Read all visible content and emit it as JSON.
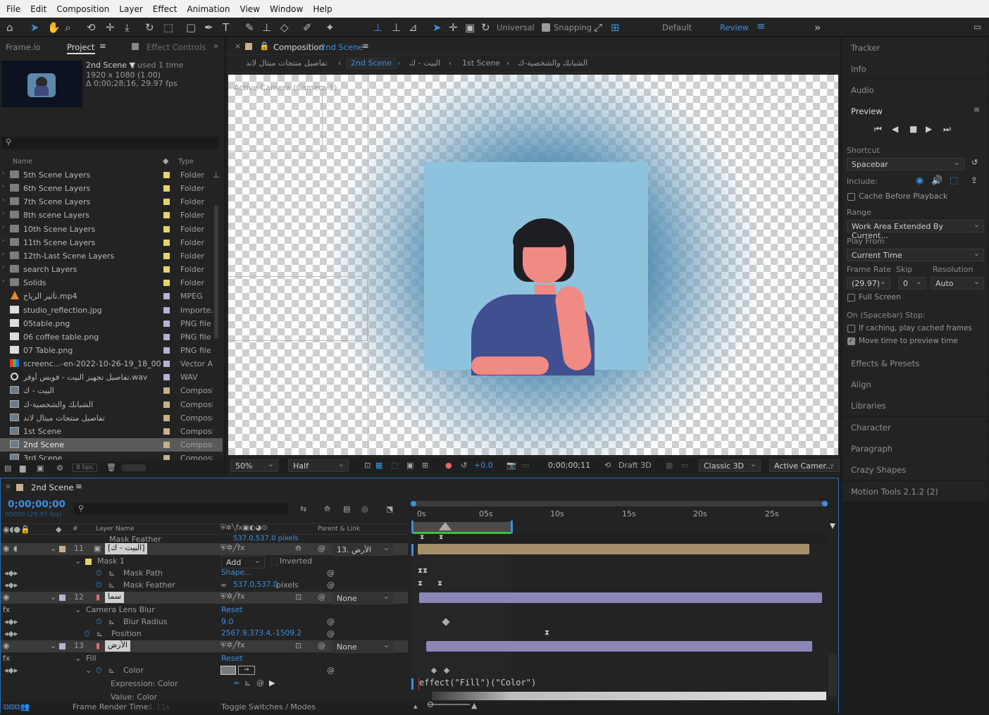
{
  "menu": [
    "File",
    "Edit",
    "Composition",
    "Layer",
    "Effect",
    "Animation",
    "View",
    "Window",
    "Help"
  ],
  "toolbar": {
    "universal": "Universal",
    "snapping": "Snapping",
    "workspace_default": "Default",
    "workspace_review": "Review"
  },
  "left_tabs": {
    "frameio": "Frame.io",
    "project": "Project",
    "effect_controls": "Effect Controls"
  },
  "project_info": {
    "name": "2nd Scene ▼",
    "used": ", used 1 time",
    "size": "1920 x 1080 (1.00)",
    "duration": "Δ 0;00;28;16, 29.97 fps"
  },
  "project_columns": {
    "name": "Name",
    "type": "Type"
  },
  "project_items": [
    {
      "name": "5th Scene Layers",
      "type": "Folder",
      "kind": "folder",
      "label": "#e8d36a"
    },
    {
      "name": "6th Scene Layers",
      "type": "Folder",
      "kind": "folder",
      "label": "#e8d36a"
    },
    {
      "name": "7th Scene Layers",
      "type": "Folder",
      "kind": "folder",
      "label": "#e8d36a"
    },
    {
      "name": "8th scene Layers",
      "type": "Folder",
      "kind": "folder",
      "label": "#e8d36a"
    },
    {
      "name": "10th Scene Layers",
      "type": "Folder",
      "kind": "folder",
      "label": "#e8d36a"
    },
    {
      "name": "11th Scene Layers",
      "type": "Folder",
      "kind": "folder",
      "label": "#e8d36a"
    },
    {
      "name": "12th-Last Scene Layers",
      "type": "Folder",
      "kind": "folder",
      "label": "#e8d36a"
    },
    {
      "name": "search Layers",
      "type": "Folder",
      "kind": "folder",
      "label": "#e8d36a"
    },
    {
      "name": "Solids",
      "type": "Folder",
      "kind": "folder",
      "label": "#e8d36a"
    },
    {
      "name": "تأثير الرياح.mp4",
      "type": "MPEG",
      "kind": "vlc",
      "label": "#b3b3d6"
    },
    {
      "name": "studio_reflection.jpg",
      "type": "Importe...",
      "kind": "file",
      "label": "#b3b3d6"
    },
    {
      "name": "05table.png",
      "type": "PNG file",
      "kind": "file",
      "label": "#b3b3d6"
    },
    {
      "name": "06 coffee table.png",
      "type": "PNG file",
      "kind": "file",
      "label": "#b3b3d6"
    },
    {
      "name": "07 Table.png",
      "type": "PNG file",
      "kind": "file",
      "label": "#b3b3d6"
    },
    {
      "name": "screenc...-en-2022-10-26-19_18_00.pdf",
      "type": "Vector Ar",
      "kind": "pdf",
      "label": "#b3b3d6"
    },
    {
      "name": "تفاصيل تجهيز البيت - فويس أوفر.wav",
      "type": "WAV",
      "kind": "wav",
      "label": "#b3b3d6"
    },
    {
      "name": "البيت - ك",
      "type": "Composi",
      "kind": "comp",
      "label": "#c9b08a"
    },
    {
      "name": "الشبابك والشخصية-ك",
      "type": "Composi",
      "kind": "comp",
      "label": "#c9b08a"
    },
    {
      "name": "تفاصيل منتجات مبتال لاند",
      "type": "Composi",
      "kind": "comp",
      "label": "#c9b08a"
    },
    {
      "name": "1st Scene",
      "type": "Composi",
      "kind": "comp",
      "label": "#c9b08a"
    },
    {
      "name": "2nd Scene",
      "type": "Composi",
      "kind": "comp",
      "label": "#c9b08a",
      "selected": true
    },
    {
      "name": "3rd Scene",
      "type": "Composi",
      "kind": "comp",
      "label": "#c9b08a"
    }
  ],
  "project_footer": {
    "bpc": "8 bpc"
  },
  "comp_panel": {
    "tab_prefix": "Composition",
    "tab_name": "2nd Scene",
    "breadcrumbs": [
      "تفاصيل منتجات مبتال لاند",
      "2nd Scene",
      "البيت - ك",
      "1st Scene",
      "الشبابك والشخصية-ك"
    ],
    "camera_label": "Active Camera (Camera 1)",
    "zoom": "50%",
    "resolution": "Half",
    "exposure": "+0.0",
    "timecode": "0;00;00;11",
    "renderer": "Draft 3D",
    "classic": "Classic 3D",
    "camera": "Active Camer..."
  },
  "right_panels": {
    "tracker": "Tracker",
    "info": "Info",
    "audio": "Audio",
    "preview": "Preview",
    "shortcut_label": "Shortcut",
    "shortcut": "Spacebar",
    "include": "Include:",
    "cache": "Cache Before Playback",
    "range_label": "Range",
    "range": "Work Area Extended By Current...",
    "playfrom_label": "Play From",
    "playfrom": "Current Time",
    "framerate_label": "Frame Rate",
    "skip_label": "Skip",
    "resolution_label": "Resolution",
    "framerate": "(29.97)",
    "skip": "0",
    "resolution": "Auto",
    "fullscreen": "Full Screen",
    "onstop": "On (Spacebar) Stop:",
    "ifcaching": "If caching, play cached frames",
    "movetime": "Move time to preview time",
    "effects": "Effects & Presets",
    "align": "Align",
    "libraries": "Libraries",
    "character": "Character",
    "paragraph": "Paragraph",
    "crazy": "Crazy Shapes",
    "motion": "Motion Tools 2.1.2 (2)"
  },
  "timeline": {
    "tab": "2nd Scene",
    "timecode": "0;00;00;00",
    "fps": "00000 (29.97 fps)",
    "col_layername": "Layer Name",
    "col_parent": "Parent & Link",
    "col_num": "#",
    "ruler": [
      "0s",
      "05s",
      "10s",
      "15s",
      "20s",
      "25s"
    ],
    "rows": {
      "r0_name": "Mask Feather",
      "r0_val": "537.0,537.0 pixels",
      "l11_num": "11",
      "l11_name": "[البيت - ك]",
      "l11_parent": "13. الأرض",
      "mask1": "Mask 1",
      "mask1_mode": "Add",
      "mask1_inverted": "Inverted",
      "maskpath": "Mask Path",
      "maskpath_val": "Shape...",
      "maskfeather": "Mask Feather",
      "maskfeather_val": "537.0,537.0",
      "maskfeather_unit": "pixels",
      "l12_num": "12",
      "l12_name": "سما",
      "l12_parent": "None",
      "camblur": "Camera Lens Blur",
      "camblur_reset": "Reset",
      "blurradius": "Blur Radius",
      "blurradius_val": "9.0",
      "position": "Position",
      "position_val": "2567.9,373.4,-1509.2",
      "l13_num": "13",
      "l13_name": "الأرض",
      "l13_parent": "None",
      "fill": "Fill",
      "fill_reset": "Reset",
      "color": "Color",
      "expr": "Expression: Color",
      "exprcode": "effect(\"Fill\")(\"Color\")",
      "valuecolor": "Value: Color"
    },
    "footer": {
      "render_time": "Frame Render Time:",
      "render_val": "1.11s",
      "toggle": "Toggle Switches / Modes"
    }
  }
}
